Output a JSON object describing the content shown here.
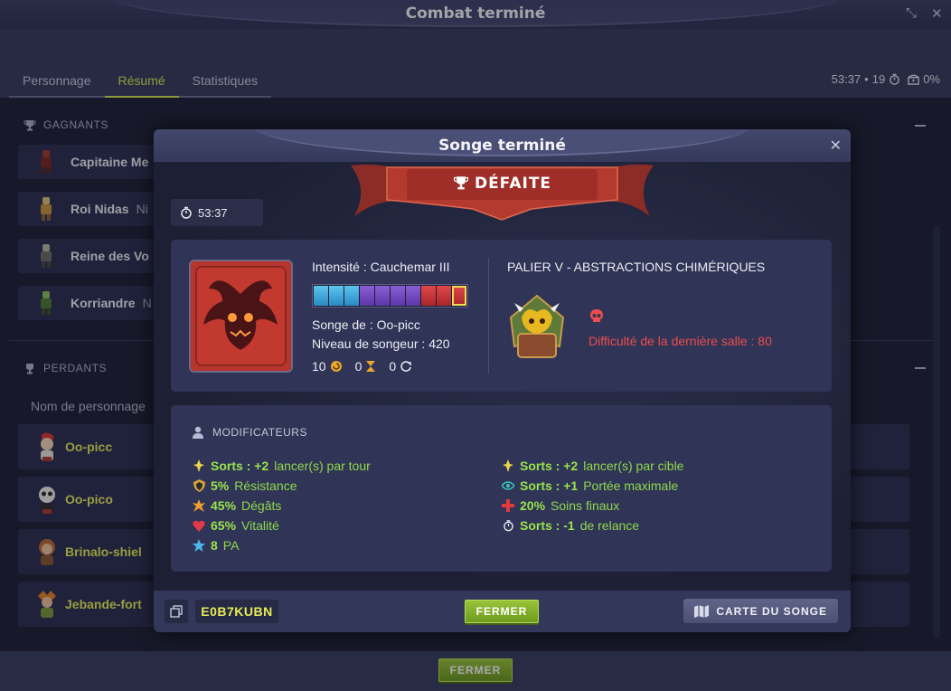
{
  "window": {
    "title": "Combat terminé",
    "tabs": [
      {
        "label": "Personnage",
        "active": false
      },
      {
        "label": "Résumé",
        "active": true
      },
      {
        "label": "Statistiques",
        "active": false
      }
    ],
    "stats": {
      "time": "53:37",
      "separator": "•",
      "turns": "19",
      "percent": "0%"
    }
  },
  "winners": {
    "label": "GAGNANTS",
    "rows": [
      {
        "name": "Capitaine Me",
        "extra": ""
      },
      {
        "name": "Roi Nidas",
        "extra": "Ni"
      },
      {
        "name": "Reine des Vo",
        "extra": ""
      },
      {
        "name": "Korriandre",
        "extra": "N"
      }
    ]
  },
  "losers": {
    "label": "PERDANTS",
    "column_header": "Nom de personnage",
    "rows": [
      {
        "name": "Oo-picc"
      },
      {
        "name": "Oo-pico"
      },
      {
        "name": "Brinalo-shiel"
      },
      {
        "name": "Jebande-fort"
      }
    ]
  },
  "bottom": {
    "close_label": "FERMER"
  },
  "modal": {
    "title": "Songe terminé",
    "result": "DÉFAITE",
    "timer": "53:37",
    "intensity": "Intensité : Cauchemar III",
    "intensity_level": {
      "total": 10,
      "current": 10
    },
    "dream_of": "Songe de : Oo-picc",
    "dreamer_level": "Niveau de songeur : 420",
    "counters": [
      {
        "value": "10",
        "icon": "spiral-icon"
      },
      {
        "value": "0",
        "icon": "hourglass-icon"
      },
      {
        "value": "0",
        "icon": "cycle-icon"
      }
    ],
    "palier": "PALIER V - ABSTRACTIONS CHIMÉRIQUES",
    "difficulty": "Difficulté de la dernière salle : 80",
    "modifiers": {
      "header": "MODIFICATEURS",
      "left": [
        {
          "icon": "spell-icon",
          "bold": "Sorts : +2",
          "text": "lancer(s) par tour"
        },
        {
          "icon": "resistance-icon",
          "bold": "5%",
          "text": "Résistance"
        },
        {
          "icon": "damage-icon",
          "bold": "45%",
          "text": "Dégâts"
        },
        {
          "icon": "heart-icon",
          "bold": "65%",
          "text": "Vitalité"
        },
        {
          "icon": "star-icon",
          "bold": "8",
          "text": "PA"
        }
      ],
      "right": [
        {
          "icon": "spell-icon",
          "bold": "Sorts : +2",
          "text": "lancer(s) par cible"
        },
        {
          "icon": "eye-icon",
          "bold": "Sorts : +1",
          "text": "Portée maximale"
        },
        {
          "icon": "heal-icon",
          "bold": "20%",
          "text": "Soins finaux"
        },
        {
          "icon": "timer-icon",
          "bold": "Sorts : -1",
          "text": "de relance"
        }
      ]
    },
    "code": "E0B7KUBN",
    "close_label": "FERMER",
    "map_label": "CARTE DU SONGE"
  },
  "colors": {
    "accent_yellow": "#d9e850",
    "defeat_red": "#ed4d4e",
    "modifier_green": "#8fd94a",
    "button_green": "#7fae2a"
  }
}
